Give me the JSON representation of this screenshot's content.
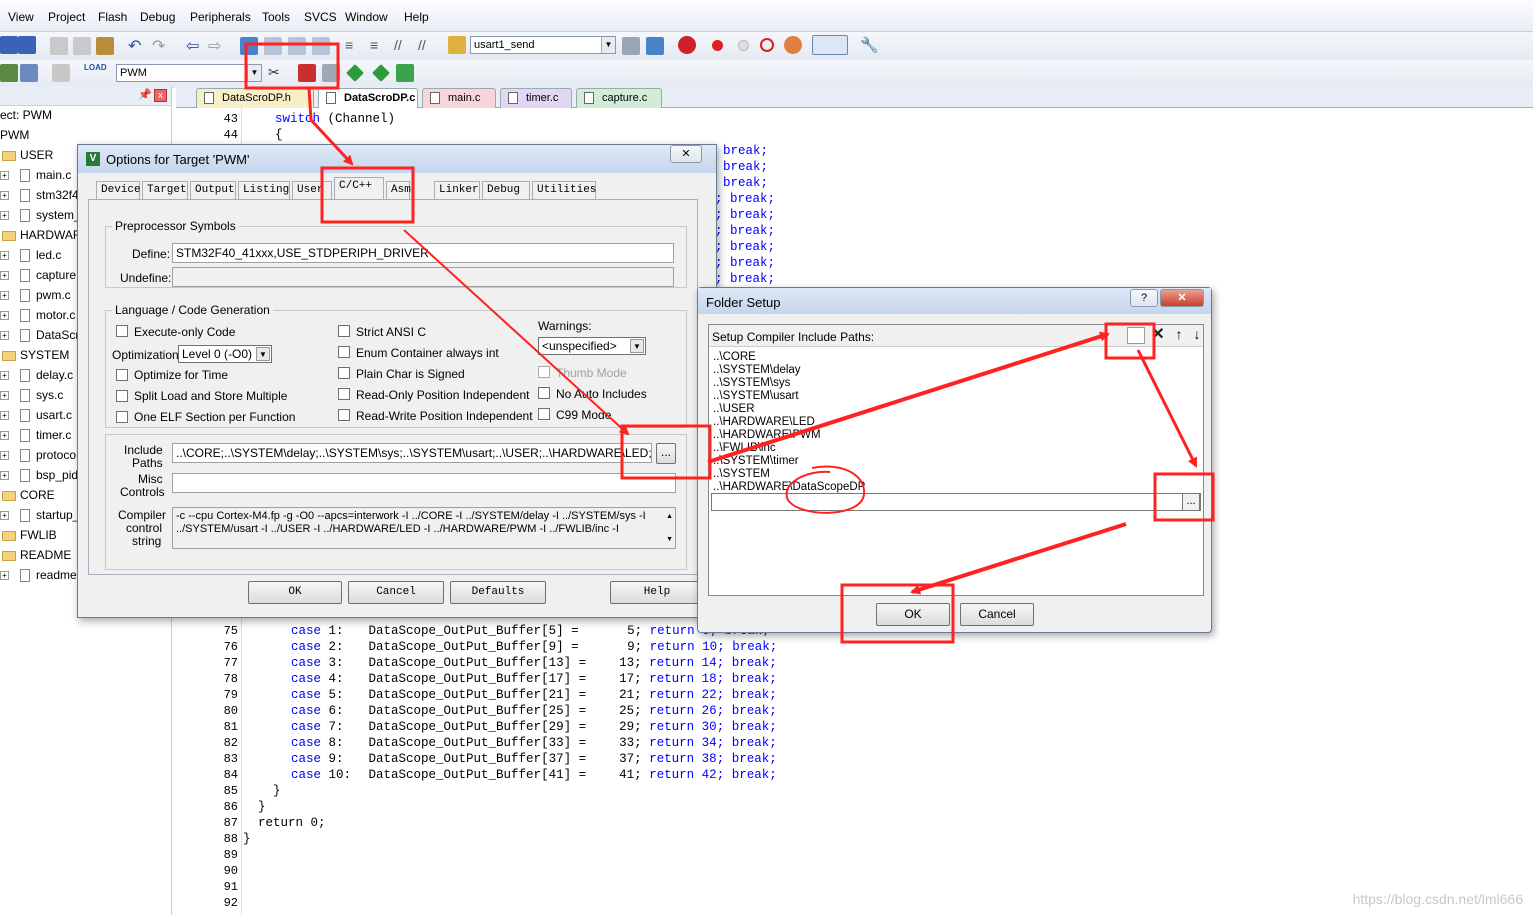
{
  "menu": [
    "View",
    "Project",
    "Flash",
    "Debug",
    "Peripherals",
    "Tools",
    "SVCS",
    "Window",
    "Help"
  ],
  "toolbar": {
    "function_combo": "usart1_send",
    "target_combo": "PWM"
  },
  "tree": {
    "rows": [
      {
        "label": "ect: PWM",
        "kind": "text"
      },
      {
        "label": "PWM",
        "kind": "text"
      },
      {
        "label": "USER",
        "kind": "folder"
      },
      {
        "label": "main.c",
        "kind": "file"
      },
      {
        "label": "stm32f4",
        "kind": "file"
      },
      {
        "label": "system_",
        "kind": "file"
      },
      {
        "label": "HARDWAR",
        "kind": "folder"
      },
      {
        "label": "led.c",
        "kind": "file"
      },
      {
        "label": "capture",
        "kind": "file"
      },
      {
        "label": "pwm.c",
        "kind": "file"
      },
      {
        "label": "motor.c",
        "kind": "file"
      },
      {
        "label": "DataScr",
        "kind": "file"
      },
      {
        "label": "SYSTEM",
        "kind": "folder"
      },
      {
        "label": "delay.c",
        "kind": "file"
      },
      {
        "label": "sys.c",
        "kind": "file"
      },
      {
        "label": "usart.c",
        "kind": "file"
      },
      {
        "label": "timer.c",
        "kind": "file"
      },
      {
        "label": "protoco",
        "kind": "file"
      },
      {
        "label": "bsp_pid",
        "kind": "file"
      },
      {
        "label": "CORE",
        "kind": "folder"
      },
      {
        "label": "startup_",
        "kind": "file"
      },
      {
        "label": "FWLIB",
        "kind": "folder"
      },
      {
        "label": "README",
        "kind": "folder"
      },
      {
        "label": "readme",
        "kind": "file"
      }
    ]
  },
  "editor_tabs": [
    {
      "label": "DataScroDP.h",
      "color": "#f7efc8"
    },
    {
      "label": "DataScroDP.c",
      "color": "#ffffff"
    },
    {
      "label": "main.c",
      "color": "#f7d5da"
    },
    {
      "label": "timer.c",
      "color": "#e1d6f3"
    },
    {
      "label": "capture.c",
      "color": "#d2ecd8"
    }
  ],
  "code": {
    "top_lines": [
      {
        "n": "43",
        "kw": "switch",
        "rest": " (Channel)"
      },
      {
        "n": "44",
        "kw": "",
        "rest": "{"
      }
    ],
    "right_fragments": [
      "break;",
      "break;",
      "break;",
      "; break;",
      "; break;",
      "; break;",
      "; break;",
      "; break;",
      "; break;"
    ],
    "cases": [
      {
        "n": "75",
        "c": "1:",
        "buf": "5",
        "v": "5",
        "r": "6"
      },
      {
        "n": "76",
        "c": "2:",
        "buf": "9",
        "v": "9",
        "r": "10"
      },
      {
        "n": "77",
        "c": "3:",
        "buf": "13",
        "v": "13",
        "r": "14"
      },
      {
        "n": "78",
        "c": "4:",
        "buf": "17",
        "v": "17",
        "r": "18"
      },
      {
        "n": "79",
        "c": "5:",
        "buf": "21",
        "v": "21",
        "r": "22"
      },
      {
        "n": "80",
        "c": "6:",
        "buf": "25",
        "v": "25",
        "r": "26"
      },
      {
        "n": "81",
        "c": "7:",
        "buf": "29",
        "v": "29",
        "r": "30"
      },
      {
        "n": "82",
        "c": "8:",
        "buf": "33",
        "v": "33",
        "r": "34"
      },
      {
        "n": "83",
        "c": "9:",
        "buf": "37",
        "v": "37",
        "r": "38"
      },
      {
        "n": "84",
        "c": "10:",
        "buf": "41",
        "v": "41",
        "r": "42"
      }
    ],
    "case_kw": "case",
    "case_fn": "DataScope_OutPut_Buffer",
    "return_kw": "return",
    "break_kw": "break;",
    "tail": [
      {
        "n": "85",
        "t": "    }"
      },
      {
        "n": "86",
        "t": "  }"
      },
      {
        "n": "87",
        "t": "  return 0;"
      },
      {
        "n": "88",
        "t": "}"
      },
      {
        "n": "89",
        "t": ""
      },
      {
        "n": "90",
        "t": ""
      },
      {
        "n": "91",
        "t": ""
      },
      {
        "n": "92",
        "t": ""
      }
    ]
  },
  "options_dialog": {
    "title": "Options for Target 'PWM'",
    "close": "✕",
    "tabs": [
      "Device",
      "Target",
      "Output",
      "Listing",
      "User",
      "C/C++",
      "Asm",
      "Linker",
      "Debug",
      "Utilities"
    ],
    "preprocessor": {
      "group": "Preprocessor Symbols",
      "define_label": "Define:",
      "define_value": "STM32F40_41xxx,USE_STDPERIPH_DRIVER",
      "undefine_label": "Undefine:",
      "undefine_value": ""
    },
    "language": {
      "group": "Language / Code Generation",
      "execute_only": "Execute-only Code",
      "optimization_label": "Optimization:",
      "optimization_value": "Level 0 (-O0)",
      "optimize_time": "Optimize for Time",
      "split_load": "Split Load and Store Multiple",
      "one_elf": "One ELF Section per Function",
      "strict_ansi": "Strict ANSI C",
      "enum_container": "Enum Container always int",
      "plain_char": "Plain Char is Signed",
      "ro_pi": "Read-Only Position Independent",
      "rw_pi": "Read-Write Position Independent",
      "warnings_label": "Warnings:",
      "warnings_value": "<unspecified>",
      "thumb_mode": "Thumb Mode",
      "no_auto": "No Auto Includes",
      "c99": "C99 Mode"
    },
    "include_label_1": "Include",
    "include_label_2": "Paths",
    "include_value": "..\\CORE;..\\SYSTEM\\delay;..\\SYSTEM\\sys;..\\SYSTEM\\usart;..\\USER;..\\HARDWARE\\LED;..\\HAR",
    "browse": "...",
    "misc_label_1": "Misc",
    "misc_label_2": "Controls",
    "misc_value": "",
    "compiler_label_1": "Compiler",
    "compiler_label_2": "control",
    "compiler_label_3": "string",
    "compiler_line1": "-c --cpu Cortex-M4.fp -g -O0 --apcs=interwork -I ../CORE -I ../SYSTEM/delay -I ../SYSTEM/sys -I",
    "compiler_line2": "../SYSTEM/usart -I ../USER -I ../HARDWARE/LED -I ../HARDWARE/PWM -I ../FWLIB/inc -I",
    "buttons": {
      "ok": "OK",
      "cancel": "Cancel",
      "defaults": "Defaults",
      "help": "Help"
    }
  },
  "folder_dialog": {
    "title": "Folder Setup",
    "help": "?",
    "close": "✕",
    "header": "Setup Compiler Include Paths:",
    "paths": [
      "..\\CORE",
      "..\\SYSTEM\\delay",
      "..\\SYSTEM\\sys",
      "..\\SYSTEM\\usart",
      "..\\USER",
      "..\\HARDWARE\\LED",
      "..\\HARDWARE\\PWM",
      "..\\FWLIB\\inc",
      "..\\SYSTEM\\timer",
      "..\\SYSTEM",
      "..\\HARDWARE\\DataScopeDP"
    ],
    "browse": "...",
    "ok": "OK",
    "cancel": "Cancel"
  },
  "watermark": "https://blog.csdn.net/lml666",
  "colors": {
    "annotation": "#f22222",
    "keyword": "#0000ff"
  }
}
